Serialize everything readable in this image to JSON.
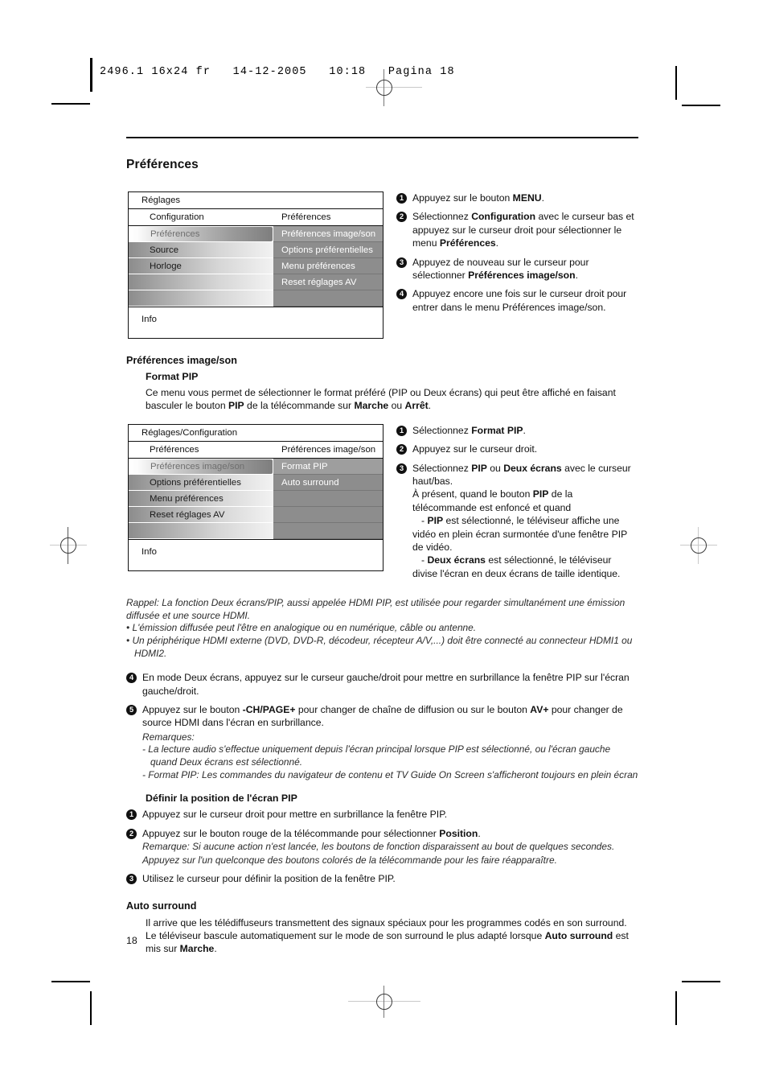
{
  "print_slug": "2496.1 16x24 fr   14-12-2005   10:18   Pagina 18",
  "page_title": "Préférences",
  "page_number": "18",
  "menu1": {
    "title": "Réglages",
    "col_head_left": "Configuration",
    "col_head_right": "Préférences",
    "left_items": [
      "Préférences",
      "Source",
      "Horloge",
      "",
      ""
    ],
    "right_items": [
      "Préférences image/son",
      "Options préférentielles",
      "Menu préférences",
      "Reset réglages AV",
      ""
    ],
    "footer": "Info"
  },
  "menu1_steps": [
    {
      "num": "1",
      "html": "Appuyez sur le bouton <b>MENU</b>."
    },
    {
      "num": "2",
      "html": "Sélectionnez <b>Configuration</b> avec le curseur bas et appuyez sur le curseur droit pour sélectionner le menu <b>Préférences</b>."
    },
    {
      "num": "3",
      "html": "Appuyez de nouveau sur le curseur pour sélectionner <b>Préférences image/son</b>."
    },
    {
      "num": "4",
      "html": "Appuyez encore une fois sur le curseur droit pour entrer dans le menu Préférences image/son."
    }
  ],
  "section_pref_image_son": "Préférences image/son",
  "format_pip": {
    "heading": "Format PIP",
    "paragraph_html": "Ce menu vous permet de sélectionner le format préféré (PIP ou Deux écrans) qui peut être affiché en faisant basculer le bouton <b>PIP</b> de la télécommande sur <b>Marche</b> ou <b>Arrêt</b>."
  },
  "menu2": {
    "title": "Réglages/Configuration",
    "col_head_left": "Préférences",
    "col_head_right": "Préférences image/son",
    "left_items": [
      "Préférences image/son",
      "Options préférentielles",
      "Menu préférences",
      "Reset réglages AV",
      ""
    ],
    "right_items": [
      "Format PIP",
      "Auto surround",
      "",
      "",
      ""
    ],
    "footer": "Info"
  },
  "menu2_steps": [
    {
      "num": "1",
      "html": "Sélectionnez <b>Format PIP</b>."
    },
    {
      "num": "2",
      "html": "Appuyez sur le curseur droit."
    },
    {
      "num": "3",
      "html": "Sélectionnez <b>PIP</b> ou <b>Deux écrans</b> avec le curseur haut/bas.<br>À présent, quand le bouton <b>PIP</b> de la télécommande est enfoncé et quand<br><span class=\"sub-dash\">- <b>PIP</b> est sélectionné, le téléviseur affiche une vidéo en plein écran surmontée d'une fenêtre PIP de vidéo.</span><br><span class=\"sub-dash\">- <b>Deux écrans</b> est sélectionné, le téléviseur divise l'écran en deux écrans de taille identique.</span>"
    }
  ],
  "rappel": {
    "lead_html": "<i>Rappel: La fonction Deux écrans/PIP, aussi appelée HDMI PIP, est utilisée pour regarder simultanément une émission diffusée et une source HDMI.</i>",
    "bullets": [
      "• L'émission diffusée peut l'être en analogique ou en numérique, câble ou antenne.",
      "• Un périphérique HDMI externe (DVD, DVD-R, décodeur, récepteur A/V,...) doit être connecté au connecteur HDMI1 ou HDMI2."
    ]
  },
  "steps_45": [
    {
      "num": "4",
      "html": "En mode Deux écrans, appuyez sur le curseur gauche/droit pour mettre en surbrillance la fenêtre PIP sur l'écran gauche/droit."
    },
    {
      "num": "5",
      "html": "Appuyez sur le bouton <b>-CH/PAGE+</b> pour changer de chaîne de diffusion ou sur le bouton <b>AV+</b> pour changer de source HDMI dans l'écran en surbrillance."
    }
  ],
  "remarques": {
    "label": "Remarques:",
    "items": [
      "- La lecture audio s'effectue uniquement depuis l'écran principal lorsque PIP est sélectionné, ou l'écran gauche quand Deux écrans est sélectionné.",
      "- Format PIP: Les commandes du navigateur de contenu et TV Guide On Screen s'afficheront toujours en plein écran"
    ]
  },
  "position_section": {
    "heading": "Définir la position de l'écran PIP",
    "steps": [
      {
        "num": "1",
        "html": "Appuyez sur le curseur droit pour mettre en surbrillance la fenêtre PIP."
      },
      {
        "num": "2",
        "html": "Appuyez sur le bouton rouge de la télécommande pour sélectionner <b>Position</b>.<br><span class=\"ital\">Remarque: Si aucune action n'est lancée, les boutons de fonction disparaissent au bout de quelques secondes. Appuyez sur l'un quelconque des boutons colorés de la télécommande pour les faire réapparaître.</span>"
      },
      {
        "num": "3",
        "html": "Utilisez le curseur pour définir la position de la fenêtre PIP."
      }
    ]
  },
  "auto_surround": {
    "heading": "Auto surround",
    "paragraph_html": "Il arrive que les télédiffuseurs transmettent des signaux spéciaux pour les programmes codés en son surround. Le téléviseur bascule automatiquement sur le mode de son surround le plus adapté lorsque <b>Auto surround</b> est mis sur <b>Marche</b>."
  }
}
